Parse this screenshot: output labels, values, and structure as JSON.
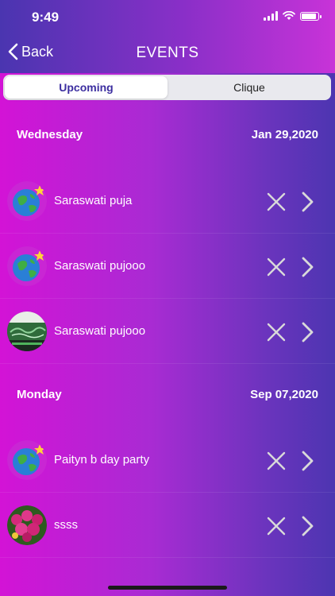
{
  "status_bar": {
    "time": "9:49"
  },
  "nav": {
    "back_label": "Back",
    "title": "EVENTS"
  },
  "tabs": [
    {
      "label": "Upcoming",
      "selected": true
    },
    {
      "label": "Clique",
      "selected": false
    }
  ],
  "groups": [
    {
      "day": "Wednesday",
      "date": "Jan 29,2020",
      "events": [
        {
          "title": "Saraswati puja",
          "avatar": "globe-icon"
        },
        {
          "title": "Saraswati pujooo",
          "avatar": "globe-icon"
        },
        {
          "title": "Saraswati pujooo",
          "avatar": "green-photo"
        }
      ]
    },
    {
      "day": "Monday",
      "date": "Sep 07,2020",
      "events": [
        {
          "title": "Paityn b day party",
          "avatar": "globe-icon"
        },
        {
          "title": "ssss",
          "avatar": "flower-photo"
        }
      ]
    }
  ],
  "colors": {
    "accent": "#3c2ea0",
    "gradient_left": "#d313d6",
    "gradient_right": "#4d35b1"
  }
}
